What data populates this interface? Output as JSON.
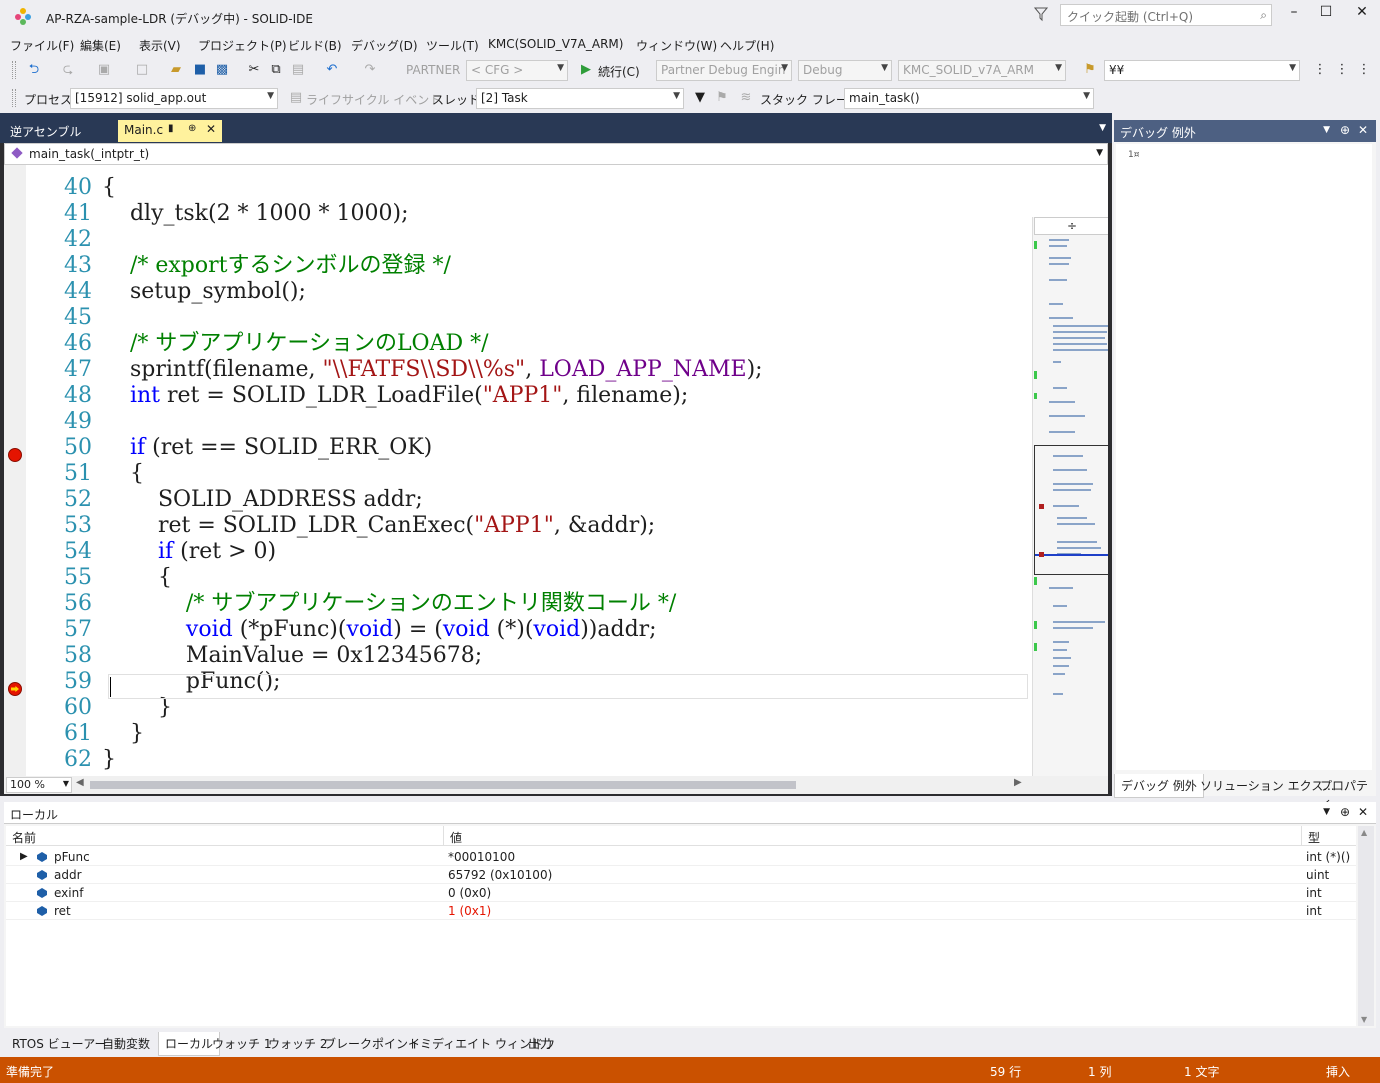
{
  "window": {
    "title": "AP-RZA-sample-LDR (デバッグ中) - SOLID-IDE",
    "quick_launch_placeholder": "クイック起動 (Ctrl+Q)",
    "minimize": "–",
    "maximize": "☐",
    "close": "✕"
  },
  "menu": [
    "ファイル(F)",
    "編集(E)",
    "表示(V)",
    "プロジェクト(P)",
    "ビルド(B)",
    "デバッグ(D)",
    "ツール(T)",
    "KMC(SOLID_V7A_ARM)",
    "ウィンドウ(W)",
    "ヘルプ(H)"
  ],
  "toolbar1": {
    "partner_label": "PARTNER",
    "cfg_combo": "< CFG >",
    "continue_label": "続行(C)",
    "partner_engine_combo": "Partner Debug Engin",
    "debug_combo": "Debug",
    "platform_combo": "KMC_SOLID_v7A_ARM",
    "yen_combo": "¥¥"
  },
  "toolbar2": {
    "process_label": "プロセス",
    "process_combo": "[15912] solid_app.out",
    "lifecycle_label": "ライフサイクル イベント",
    "thread_label": "スレッド",
    "thread_combo": "[2] Task",
    "stackframe_label": "スタック フレーム",
    "stackframe_combo": "main_task()"
  },
  "editor": {
    "tab_disasm": "逆アセンブル",
    "tab_main": "Main.c",
    "nav_function": "main_task(_intptr_t)",
    "zoom": "100 %",
    "line_numbers": [
      "40",
      "41",
      "42",
      "43",
      "44",
      "45",
      "46",
      "47",
      "48",
      "49",
      "50",
      "51",
      "52",
      "53",
      "54",
      "55",
      "56",
      "57",
      "58",
      "59",
      "60",
      "61",
      "62"
    ],
    "code": {
      "l40": "{",
      "l41": "    dly_tsk(2 * 1000 * 1000);",
      "l43_cm": "    /* exportするシンボルの登録 */",
      "l44": "    setup_symbol();",
      "l46_cm": "    /* サブアプリケーションのLOAD */",
      "l47_a": "    sprintf(filename, ",
      "l47_str": "\"\\\\FATFS\\\\SD\\\\%s\"",
      "l47_b": ", ",
      "l47_mac": "LOAD_APP_NAME",
      "l47_c": ");",
      "l48_kw": "    int",
      "l48_a": " ret = SOLID_LDR_LoadFile(",
      "l48_str": "\"APP1\"",
      "l48_b": ", filename);",
      "l50_kw": "    if",
      "l50_a": " (ret == SOLID_ERR_OK)",
      "l51": "    {",
      "l52": "        SOLID_ADDRESS addr;",
      "l53_a": "        ret = SOLID_LDR_CanExec(",
      "l53_str": "\"APP1\"",
      "l53_b": ", &addr);",
      "l54_kw": "        if",
      "l54_a": " (ret > 0)",
      "l55": "        {",
      "l56_cm": "            /* サブアプリケーションのエントリ関数コール */",
      "l57_kw1": "            void",
      "l57_a": " (*pFunc)(",
      "l57_kw2": "void",
      "l57_b": ") = (",
      "l57_kw3": "void",
      "l57_c": " (*)(",
      "l57_kw4": "void",
      "l57_d": "))addr;",
      "l58": "            MainValue = 0x12345678;",
      "l59": "            pFunc();",
      "l60": "        }",
      "l61": "    }",
      "l62": "}"
    }
  },
  "right_panel": {
    "title": "デバッグ 例外",
    "body_text": "1¤",
    "tabs": [
      "デバッグ 例外",
      "ソリューション エクス...",
      "プロパティ"
    ]
  },
  "locals": {
    "title": "ローカル",
    "columns": [
      "名前",
      "値",
      "型"
    ],
    "rows": [
      {
        "name": "pFunc",
        "value": "*00010100",
        "type": "int (*)()"
      },
      {
        "name": "addr",
        "value": "65792 (0x10100)",
        "type": "uint"
      },
      {
        "name": "exinf",
        "value": "0 (0x0)",
        "type": "int"
      },
      {
        "name": "ret",
        "value": "1 (0x1)",
        "type": "int"
      }
    ]
  },
  "bottom_tabs": [
    "RTOS ビューアー",
    "自動変数",
    "ローカル",
    "ウォッチ 1",
    "ウォッチ 2",
    "ブレークポイント",
    "イミディエイト ウィンドウ",
    "出力"
  ],
  "status": {
    "ready": "準備完了",
    "line": "59 行",
    "col": "1 列",
    "char": "1 文字",
    "mode": "挿入"
  },
  "colors": {
    "accent_status": "#ca5100",
    "tab_active": "#fff29d",
    "doc_header": "#293955",
    "keyword": "#0000ff",
    "comment": "#008000",
    "string": "#a31515",
    "macro": "#6f008a",
    "line_number": "#2b91af"
  }
}
